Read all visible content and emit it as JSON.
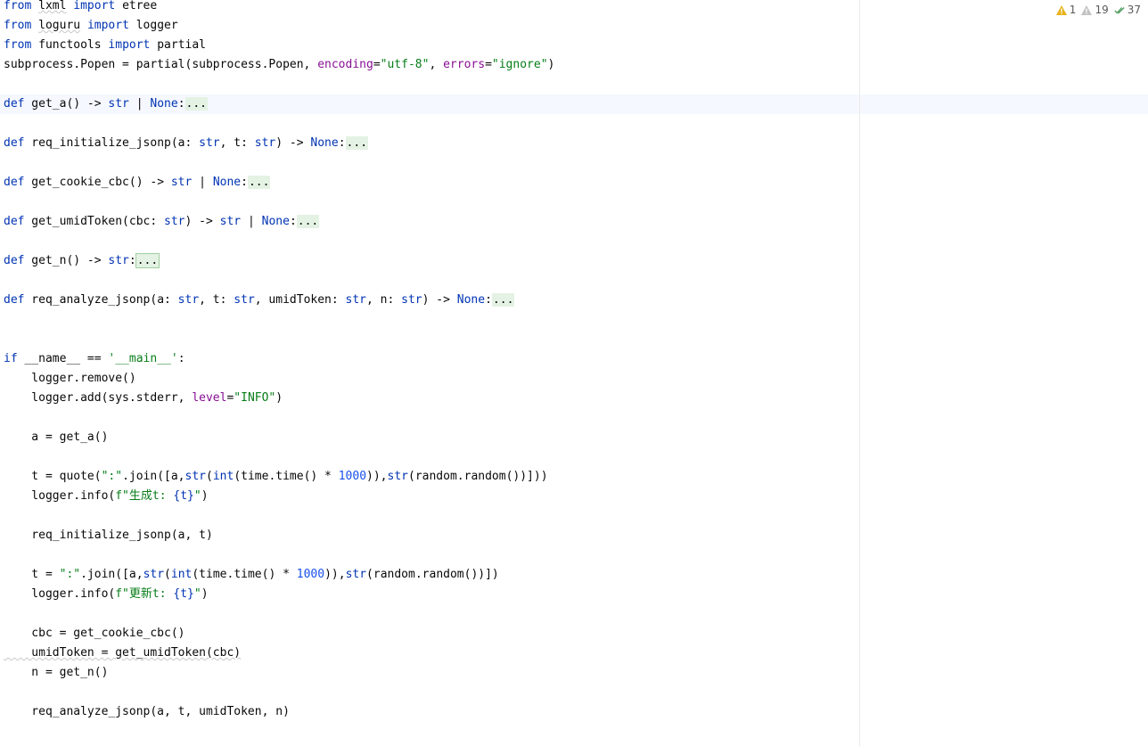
{
  "inspections": {
    "errors": "1",
    "warnings": "19",
    "checks": "37"
  },
  "colors": {
    "keyword": "#0033b3",
    "string": "#067d17",
    "number": "#1750eb",
    "param": "#871094",
    "fold_bg": "#e4f2e4"
  },
  "code": {
    "l1_from": "from",
    "l1_mod": "lxml",
    "l1_import": "import",
    "l1_name": "etree",
    "l2_from": "from",
    "l2_mod": "loguru",
    "l2_import": "import",
    "l2_name": "logger",
    "l3_from": "from",
    "l3_mod": "functools",
    "l3_import": "import",
    "l3_name": "partial",
    "l4_a": "subprocess.Popen = partial(subprocess.Popen, ",
    "l4_p1": "encoding",
    "l4_eq1": "=",
    "l4_s1": "\"utf-8\"",
    "l4_comma": ", ",
    "l4_p2": "errors",
    "l4_eq2": "=",
    "l4_s2": "\"ignore\"",
    "l4_end": ")",
    "f1_def": "def",
    "f1_name": " get_a() -> ",
    "f1_t1": "str",
    "f1_bar": " | ",
    "f1_t2": "None",
    "f1_colon": ":",
    "fold": "...",
    "f2_def": "def",
    "f2_name": " req_initialize_jsonp(a: ",
    "f2_t1": "str",
    "f2_mid": ", t: ",
    "f2_t2": "str",
    "f2_arrow": ") -> ",
    "f2_t3": "None",
    "f2_colon": ":",
    "f3_def": "def",
    "f3_name": " get_cookie_cbc() -> ",
    "f3_t1": "str",
    "f3_bar": " | ",
    "f3_t2": "None",
    "f3_colon": ":",
    "f4_def": "def",
    "f4_name": " get_umidToken(cbc: ",
    "f4_t1": "str",
    "f4_arrow": ") -> ",
    "f4_t2": "str",
    "f4_bar": " | ",
    "f4_t3": "None",
    "f4_colon": ":",
    "f5_def": "def",
    "f5_name": " get_n() -> ",
    "f5_t1": "str",
    "f5_colon": ":",
    "f6_def": "def",
    "f6_name": " req_analyze_jsonp(a: ",
    "f6_t1": "str",
    "f6_m1": ", t: ",
    "f6_t2": "str",
    "f6_m2": ", umidToken: ",
    "f6_t3": "str",
    "f6_m3": ", n: ",
    "f6_t4": "str",
    "f6_arrow": ") -> ",
    "f6_t5": "None",
    "f6_colon": ":",
    "m_if": "if",
    "m_cond": " __name__ == ",
    "m_str": "'__main__'",
    "m_colon": ":",
    "m1": "    logger.remove()",
    "m2_a": "    logger.add(sys.stderr, ",
    "m2_p": "level",
    "m2_eq": "=",
    "m2_s": "\"INFO\"",
    "m2_end": ")",
    "m3": "    a = get_a()",
    "m4_a": "    t = quote(",
    "m4_s": "\":\"",
    "m4_b": ".join([a,",
    "m4_str": "str",
    "m4_c": "(",
    "m4_int": "int",
    "m4_d": "(time.time() * ",
    "m4_num": "1000",
    "m4_e": ")),",
    "m4_str2": "str",
    "m4_f": "(random.random())]))",
    "m5_a": "    logger.info(",
    "m5_s": "f\"生成t: ",
    "m5_brace": "{t}",
    "m5_q": "\"",
    "m5_end": ")",
    "m6": "    req_initialize_jsonp(a, t)",
    "m7_a": "    t = ",
    "m7_s": "\":\"",
    "m7_b": ".join([a,",
    "m7_str": "str",
    "m7_c": "(",
    "m7_int": "int",
    "m7_d": "(time.time() * ",
    "m7_num": "1000",
    "m7_e": ")),",
    "m7_str2": "str",
    "m7_f": "(random.random())])",
    "m8_a": "    logger.info(",
    "m8_s": "f\"更新t: ",
    "m8_brace": "{t}",
    "m8_q": "\"",
    "m8_end": ")",
    "m9": "    cbc = get_cookie_cbc()",
    "m10": "    umidToken = get_umidToken(cbc)",
    "m11": "    n = get_n()",
    "m12": "    req_analyze_jsonp(a, t, umidToken, n)"
  }
}
